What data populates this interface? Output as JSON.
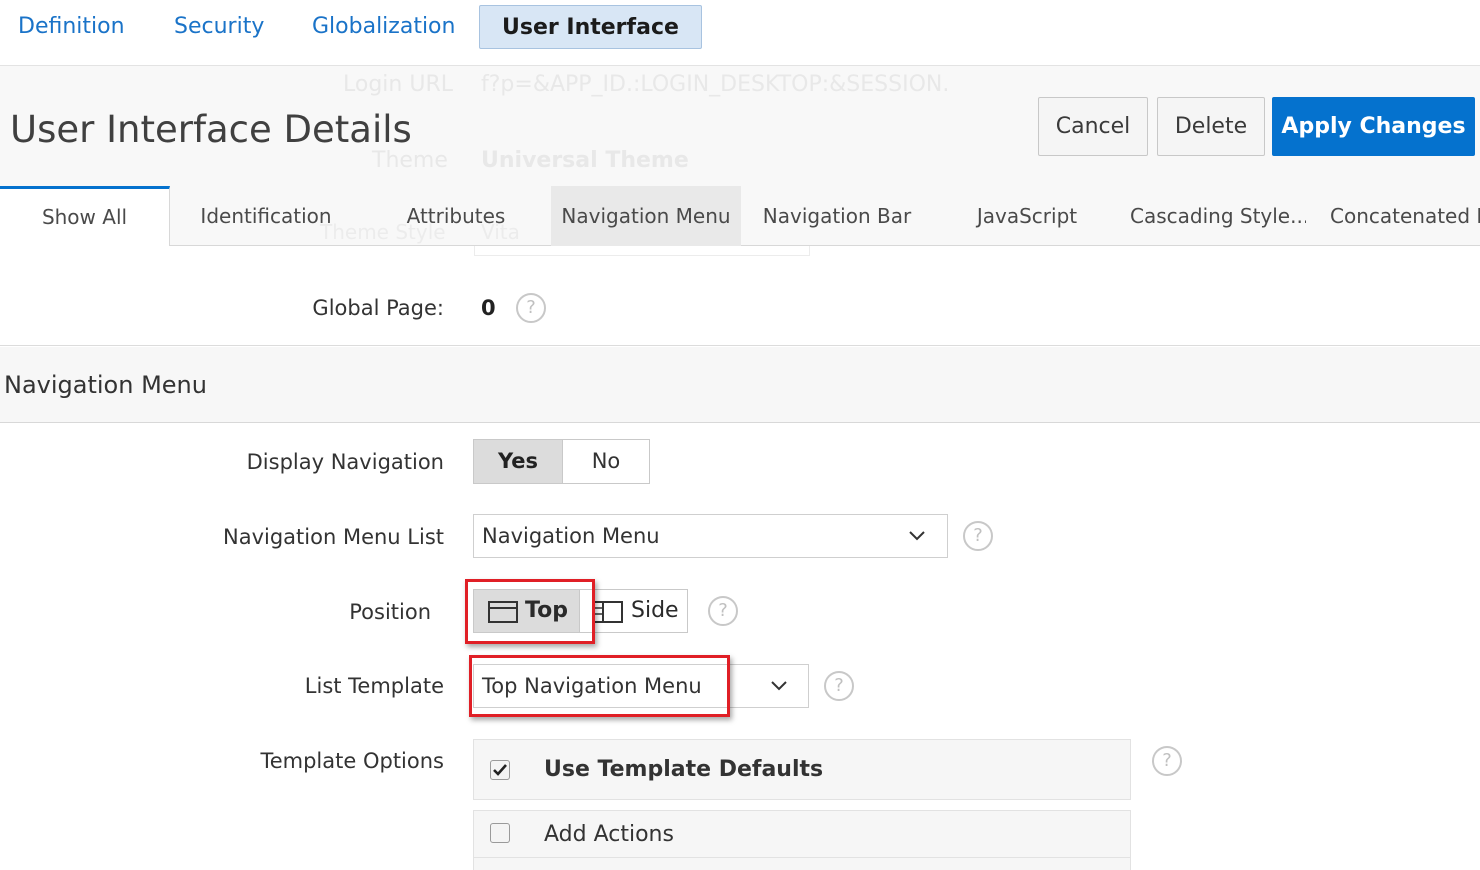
{
  "top_tabs": [
    {
      "label": "Definition"
    },
    {
      "label": "Security"
    },
    {
      "label": "Globalization"
    },
    {
      "label": "User Interface",
      "active": true
    }
  ],
  "background_ghost": {
    "login_url_label": "Login URL",
    "login_url_value": "f?p=&APP_ID.:LOGIN_DESKTOP:&SESSION.",
    "theme_label": "Theme",
    "theme_value": "Universal Theme",
    "theme_style_label": "Theme Style",
    "theme_style_value": "Vita"
  },
  "header": {
    "title": "User Interface Details",
    "cancel_label": "Cancel",
    "delete_label": "Delete",
    "apply_label": "Apply Changes"
  },
  "region_tabs": [
    {
      "label": "Show All",
      "selected": true
    },
    {
      "label": "Identification"
    },
    {
      "label": "Attributes"
    },
    {
      "label": "Navigation Menu",
      "hover": true
    },
    {
      "label": "Navigation Bar"
    },
    {
      "label": "JavaScript"
    },
    {
      "label": "Cascading Style..."
    },
    {
      "label": "Concatenated F..."
    }
  ],
  "global_page": {
    "label": "Global Page:",
    "value": "0"
  },
  "section": {
    "title": "Navigation Menu"
  },
  "display_navigation": {
    "label": "Display Navigation",
    "yes_label": "Yes",
    "no_label": "No",
    "selected": "Yes"
  },
  "navigation_menu_list": {
    "label": "Navigation Menu List",
    "value": "Navigation Menu"
  },
  "position": {
    "label": "Position",
    "top_label": "Top",
    "side_label": "Side",
    "selected": "Top"
  },
  "list_template": {
    "label": "List Template",
    "value": "Top Navigation Menu"
  },
  "template_options": {
    "label": "Template Options",
    "use_defaults_label": "Use Template Defaults",
    "use_defaults_checked": true,
    "add_actions_label": "Add Actions",
    "add_actions_checked": false
  },
  "help_glyph": "?",
  "colors": {
    "accent": "#0572ce",
    "link": "#1a73c8",
    "highlight": "#e01f26"
  }
}
